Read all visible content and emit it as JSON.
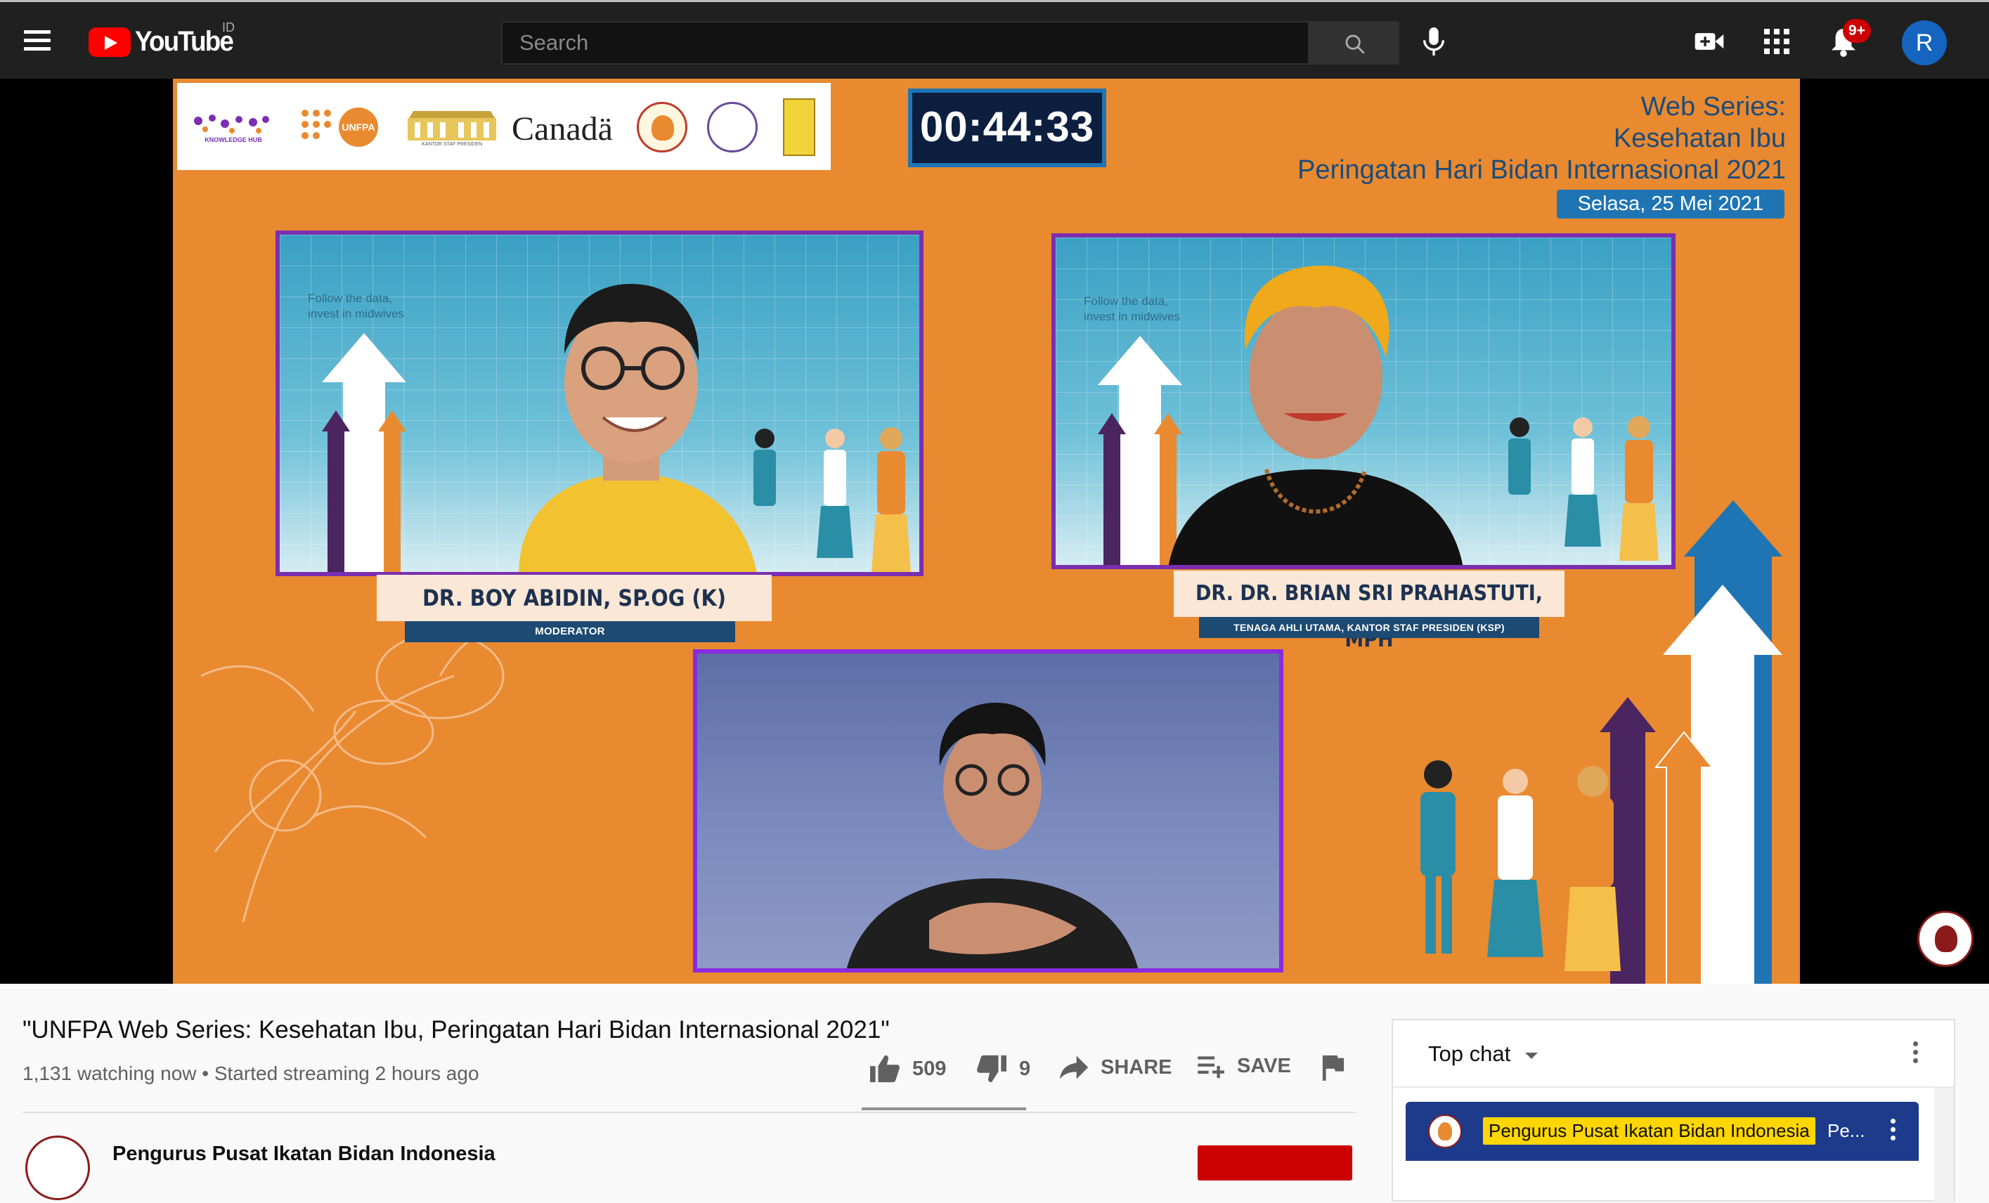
{
  "app": {
    "logo_text": "YouTube",
    "region": "ID"
  },
  "search": {
    "placeholder": "Search",
    "value": ""
  },
  "header": {
    "notifications_badge": "9+",
    "avatar_initial": "R"
  },
  "stream": {
    "timer": "00:44:33",
    "series_title_lines": [
      "Web Series:",
      "Kesehatan Ibu",
      "Peringatan Hari Bidan Internasional 2021"
    ],
    "date_label": "Selasa, 25 Mei 2021",
    "sponsors": {
      "knowledge_hub": "KNOWLEDGE HUB",
      "unfpa": "UNFPA",
      "ksp": "KANTOR STAF PRESIDEN",
      "canada": "Canadä"
    },
    "panelists": [
      {
        "name": "DR. BOY ABIDIN, SP.OG (K)",
        "role": "MODERATOR",
        "note": "Follow the data,\ninvest in midwives"
      },
      {
        "name": "DR. DR. BRIAN SRI PRAHASTUTI, MPH",
        "role": "TENAGA AHLI UTAMA, KANTOR STAF PRESIDEN (KSP)",
        "note": "Follow the data,\ninvest in midwives"
      }
    ]
  },
  "video": {
    "title": "\"UNFPA Web Series: Kesehatan Ibu, Peringatan Hari Bidan Internasional 2021\"",
    "meta": "1,131 watching now • Started streaming 2 hours ago",
    "likes": "509",
    "dislikes": "9",
    "share_label": "SHARE",
    "save_label": "SAVE",
    "channel_name": "Pengurus Pusat Ikatan Bidan Indonesia"
  },
  "chat": {
    "mode_label": "Top chat",
    "pinned_author": "Pengurus Pusat Ikatan Bidan Indonesia",
    "pinned_message": "Pe..."
  },
  "colors": {
    "brand_red": "#ff0000",
    "slide_orange": "#e98a30",
    "tile_border": "#7b2fb0",
    "chat_pinned_bg": "#1e3a8a",
    "author_highlight": "#ffd600"
  },
  "icons": [
    "menu-icon",
    "search-icon",
    "mic-icon",
    "create-video-icon",
    "apps-icon",
    "bell-icon",
    "thumb-up-icon",
    "thumb-down-icon",
    "share-icon",
    "save-playlist-icon",
    "flag-icon",
    "more-vert-icon"
  ]
}
